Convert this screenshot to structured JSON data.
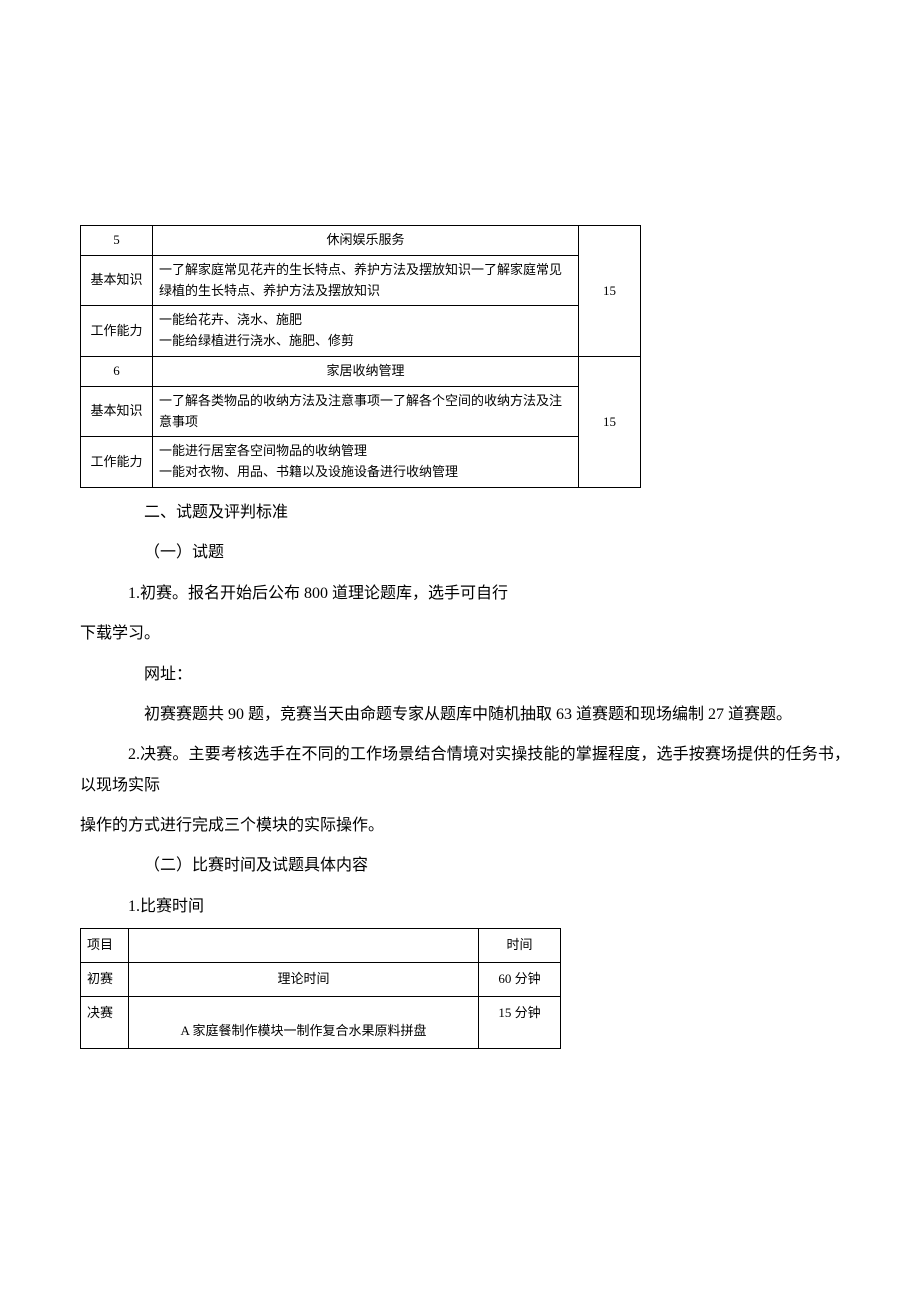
{
  "table1": {
    "sections": [
      {
        "num": "5",
        "title": "休闲娱乐服务",
        "score": "15",
        "rows": [
          {
            "label": "基本知识",
            "text": "一了解家庭常见花卉的生长特点、养护方法及摆放知识一了解家庭常见绿植的生长特点、养护方法及摆放知识"
          },
          {
            "label": "工作能力",
            "text": "一能给花卉、浇水、施肥\n一能给绿植进行浇水、施肥、修剪"
          }
        ]
      },
      {
        "num": "6",
        "title": "家居收纳管理",
        "score": "15",
        "rows": [
          {
            "label": "基本知识",
            "text": "一了解各类物品的收纳方法及注意事项一了解各个空间的收纳方法及注意事项"
          },
          {
            "label": "工作能力",
            "text": "一能进行居室各空间物品的收纳管理\n一能对衣物、用品、书籍以及设施设备进行收纳管理"
          }
        ]
      }
    ]
  },
  "body": {
    "h2": "二、试题及评判标准",
    "h2_1": "（一）试题",
    "p1a": "1.初赛。报名开始后公布 800 道理论题库，选手可自行",
    "p1b": "下载学习。",
    "p2": "网址：",
    "p3": "初赛赛题共 90 题，竞赛当天由命题专家从题库中随机抽取 63 道赛题和现场编制 27 道赛题。",
    "p4a": "2.决赛。主要考核选手在不同的工作场景结合情境对实操技能的掌握程度，选手按赛场提供的任务书，以现场实际",
    "p4b": "操作的方式进行完成三个模块的实际操作。",
    "h2_2": "（二）比赛时间及试题具体内容",
    "h3_1": "1.比赛时间"
  },
  "table2": {
    "header": {
      "c1": "项目",
      "c2": "",
      "c3": "时间"
    },
    "rows": [
      {
        "c1": "初赛",
        "c2": "理论时间",
        "c3": "60 分钟",
        "tall": false
      },
      {
        "c1": "决赛",
        "c2": "A 家庭餐制作模块一制作复合水果原料拼盘",
        "c3": "15 分钟",
        "tall": true
      }
    ]
  }
}
